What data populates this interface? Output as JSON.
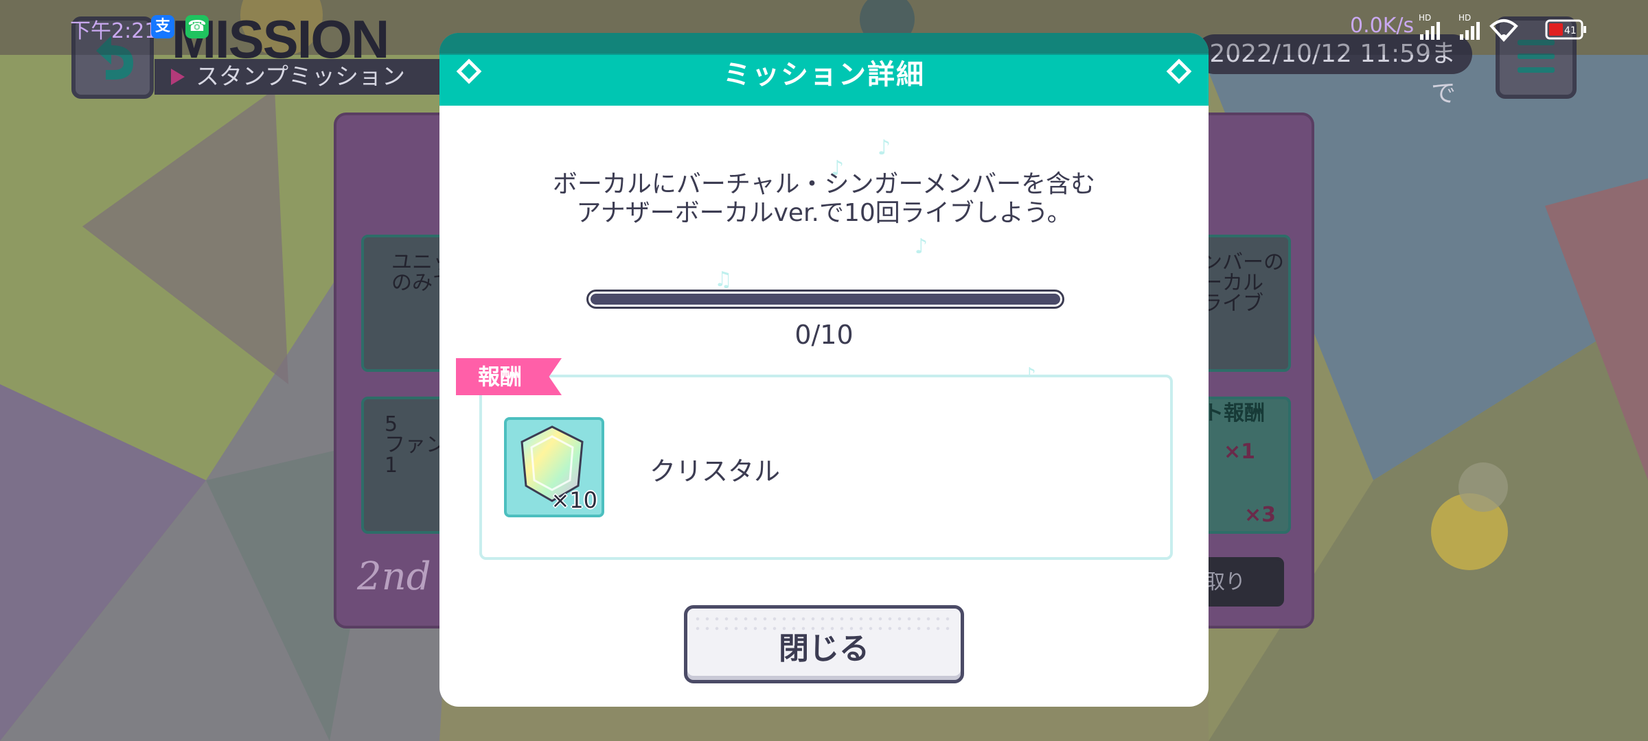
{
  "status_bar": {
    "time": "下午2:21",
    "app_icons": [
      "alipay-icon",
      "phone-icon"
    ],
    "net_speed": "0.0K/s",
    "signal_labels": [
      "HD",
      "HD"
    ],
    "battery": "41"
  },
  "header": {
    "title": "MISSION",
    "subtitle": "スタンプミッション",
    "deadline": "2022/10/12 11:59まで"
  },
  "background_cards": {
    "left_top": "ユニッ\nのみで",
    "left_bottom": "5\nファン\n1",
    "right_top": "ンバーの\nーカル\nライブ",
    "right_reward_label": "ト報酬",
    "right_x1": "×1",
    "right_x3": "×3",
    "right_button": "取り",
    "signature": "2nd"
  },
  "modal": {
    "title": "ミッション詳細",
    "description_line1": "ボーカルにバーチャル・シンガーメンバーを含む",
    "description_line2": "アナザーボーカルver.で10回ライブしよう。",
    "progress": {
      "current": 0,
      "total": 10,
      "text": "0/10"
    },
    "reward_tag": "報酬",
    "reward": {
      "icon": "crystal-icon",
      "quantity": "×10",
      "name": "クリスタル"
    },
    "close_button": "閉じる"
  },
  "colors": {
    "accent_teal": "#00c6b2",
    "reward_pink": "#ff5fa8",
    "text_dark": "#3c3c52",
    "nav_arrow": "#c2185b"
  }
}
